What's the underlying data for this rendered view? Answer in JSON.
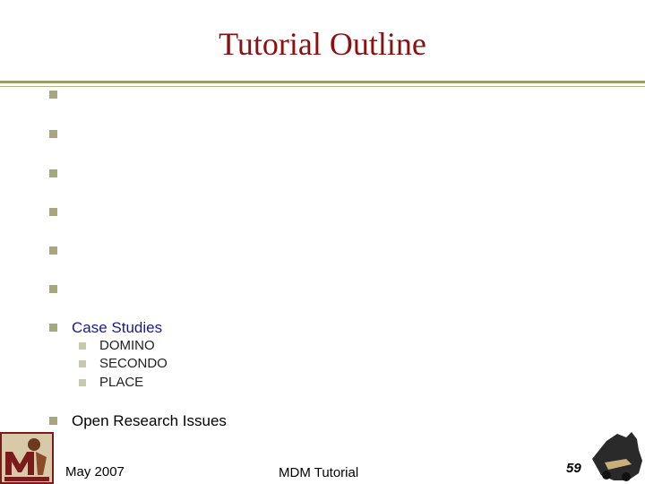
{
  "slide": {
    "title": "Tutorial Outline",
    "items": [
      {
        "label": "Case Studies",
        "subitems": [
          "DOMINO",
          "SECONDO",
          "PLACE"
        ]
      },
      {
        "label": "Open Research Issues"
      }
    ]
  },
  "footer": {
    "date": "May 2007",
    "center": "MDM Tutorial",
    "page_number": "59"
  },
  "colors": {
    "title": "#8b1010",
    "rule": "#9b9a63",
    "bullet": "#a8a77a",
    "item_highlight": "#1a1a8c"
  },
  "logos": {
    "left": "university-seal-logo",
    "right": "purdue-train-logo"
  }
}
